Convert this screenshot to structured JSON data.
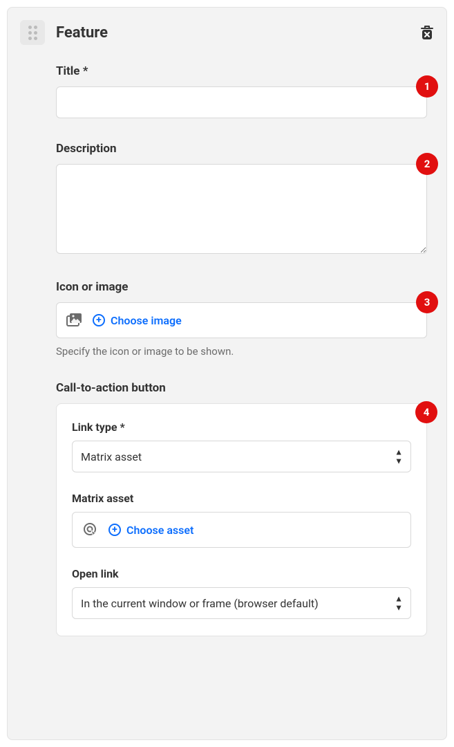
{
  "panel": {
    "title": "Feature"
  },
  "fields": {
    "title": {
      "label": "Title *",
      "value": ""
    },
    "description": {
      "label": "Description",
      "value": ""
    },
    "iconImage": {
      "label": "Icon or image",
      "chooseLabel": "Choose image",
      "helpText": "Specify the icon or image to be shown."
    },
    "cta": {
      "label": "Call-to-action button",
      "linkType": {
        "label": "Link type *",
        "value": "Matrix asset"
      },
      "matrixAsset": {
        "label": "Matrix asset",
        "chooseLabel": "Choose asset"
      },
      "openLink": {
        "label": "Open link",
        "value": "In the current window or frame (browser default)"
      }
    }
  },
  "badges": {
    "b1": "1",
    "b2": "2",
    "b3": "3",
    "b4": "4"
  }
}
